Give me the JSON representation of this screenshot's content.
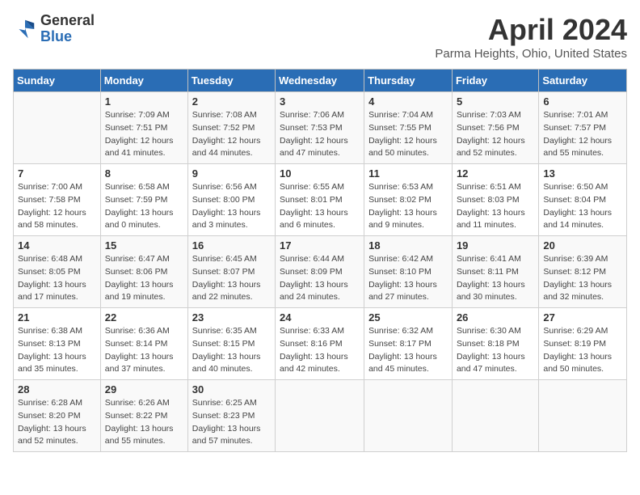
{
  "header": {
    "logo": {
      "general": "General",
      "blue": "Blue"
    },
    "title": "April 2024",
    "location": "Parma Heights, Ohio, United States"
  },
  "weekdays": [
    "Sunday",
    "Monday",
    "Tuesday",
    "Wednesday",
    "Thursday",
    "Friday",
    "Saturday"
  ],
  "weeks": [
    [
      {
        "day": "",
        "sunrise": "",
        "sunset": "",
        "daylight": ""
      },
      {
        "day": "1",
        "sunrise": "Sunrise: 7:09 AM",
        "sunset": "Sunset: 7:51 PM",
        "daylight": "Daylight: 12 hours and 41 minutes."
      },
      {
        "day": "2",
        "sunrise": "Sunrise: 7:08 AM",
        "sunset": "Sunset: 7:52 PM",
        "daylight": "Daylight: 12 hours and 44 minutes."
      },
      {
        "day": "3",
        "sunrise": "Sunrise: 7:06 AM",
        "sunset": "Sunset: 7:53 PM",
        "daylight": "Daylight: 12 hours and 47 minutes."
      },
      {
        "day": "4",
        "sunrise": "Sunrise: 7:04 AM",
        "sunset": "Sunset: 7:55 PM",
        "daylight": "Daylight: 12 hours and 50 minutes."
      },
      {
        "day": "5",
        "sunrise": "Sunrise: 7:03 AM",
        "sunset": "Sunset: 7:56 PM",
        "daylight": "Daylight: 12 hours and 52 minutes."
      },
      {
        "day": "6",
        "sunrise": "Sunrise: 7:01 AM",
        "sunset": "Sunset: 7:57 PM",
        "daylight": "Daylight: 12 hours and 55 minutes."
      }
    ],
    [
      {
        "day": "7",
        "sunrise": "Sunrise: 7:00 AM",
        "sunset": "Sunset: 7:58 PM",
        "daylight": "Daylight: 12 hours and 58 minutes."
      },
      {
        "day": "8",
        "sunrise": "Sunrise: 6:58 AM",
        "sunset": "Sunset: 7:59 PM",
        "daylight": "Daylight: 13 hours and 0 minutes."
      },
      {
        "day": "9",
        "sunrise": "Sunrise: 6:56 AM",
        "sunset": "Sunset: 8:00 PM",
        "daylight": "Daylight: 13 hours and 3 minutes."
      },
      {
        "day": "10",
        "sunrise": "Sunrise: 6:55 AM",
        "sunset": "Sunset: 8:01 PM",
        "daylight": "Daylight: 13 hours and 6 minutes."
      },
      {
        "day": "11",
        "sunrise": "Sunrise: 6:53 AM",
        "sunset": "Sunset: 8:02 PM",
        "daylight": "Daylight: 13 hours and 9 minutes."
      },
      {
        "day": "12",
        "sunrise": "Sunrise: 6:51 AM",
        "sunset": "Sunset: 8:03 PM",
        "daylight": "Daylight: 13 hours and 11 minutes."
      },
      {
        "day": "13",
        "sunrise": "Sunrise: 6:50 AM",
        "sunset": "Sunset: 8:04 PM",
        "daylight": "Daylight: 13 hours and 14 minutes."
      }
    ],
    [
      {
        "day": "14",
        "sunrise": "Sunrise: 6:48 AM",
        "sunset": "Sunset: 8:05 PM",
        "daylight": "Daylight: 13 hours and 17 minutes."
      },
      {
        "day": "15",
        "sunrise": "Sunrise: 6:47 AM",
        "sunset": "Sunset: 8:06 PM",
        "daylight": "Daylight: 13 hours and 19 minutes."
      },
      {
        "day": "16",
        "sunrise": "Sunrise: 6:45 AM",
        "sunset": "Sunset: 8:07 PM",
        "daylight": "Daylight: 13 hours and 22 minutes."
      },
      {
        "day": "17",
        "sunrise": "Sunrise: 6:44 AM",
        "sunset": "Sunset: 8:09 PM",
        "daylight": "Daylight: 13 hours and 24 minutes."
      },
      {
        "day": "18",
        "sunrise": "Sunrise: 6:42 AM",
        "sunset": "Sunset: 8:10 PM",
        "daylight": "Daylight: 13 hours and 27 minutes."
      },
      {
        "day": "19",
        "sunrise": "Sunrise: 6:41 AM",
        "sunset": "Sunset: 8:11 PM",
        "daylight": "Daylight: 13 hours and 30 minutes."
      },
      {
        "day": "20",
        "sunrise": "Sunrise: 6:39 AM",
        "sunset": "Sunset: 8:12 PM",
        "daylight": "Daylight: 13 hours and 32 minutes."
      }
    ],
    [
      {
        "day": "21",
        "sunrise": "Sunrise: 6:38 AM",
        "sunset": "Sunset: 8:13 PM",
        "daylight": "Daylight: 13 hours and 35 minutes."
      },
      {
        "day": "22",
        "sunrise": "Sunrise: 6:36 AM",
        "sunset": "Sunset: 8:14 PM",
        "daylight": "Daylight: 13 hours and 37 minutes."
      },
      {
        "day": "23",
        "sunrise": "Sunrise: 6:35 AM",
        "sunset": "Sunset: 8:15 PM",
        "daylight": "Daylight: 13 hours and 40 minutes."
      },
      {
        "day": "24",
        "sunrise": "Sunrise: 6:33 AM",
        "sunset": "Sunset: 8:16 PM",
        "daylight": "Daylight: 13 hours and 42 minutes."
      },
      {
        "day": "25",
        "sunrise": "Sunrise: 6:32 AM",
        "sunset": "Sunset: 8:17 PM",
        "daylight": "Daylight: 13 hours and 45 minutes."
      },
      {
        "day": "26",
        "sunrise": "Sunrise: 6:30 AM",
        "sunset": "Sunset: 8:18 PM",
        "daylight": "Daylight: 13 hours and 47 minutes."
      },
      {
        "day": "27",
        "sunrise": "Sunrise: 6:29 AM",
        "sunset": "Sunset: 8:19 PM",
        "daylight": "Daylight: 13 hours and 50 minutes."
      }
    ],
    [
      {
        "day": "28",
        "sunrise": "Sunrise: 6:28 AM",
        "sunset": "Sunset: 8:20 PM",
        "daylight": "Daylight: 13 hours and 52 minutes."
      },
      {
        "day": "29",
        "sunrise": "Sunrise: 6:26 AM",
        "sunset": "Sunset: 8:22 PM",
        "daylight": "Daylight: 13 hours and 55 minutes."
      },
      {
        "day": "30",
        "sunrise": "Sunrise: 6:25 AM",
        "sunset": "Sunset: 8:23 PM",
        "daylight": "Daylight: 13 hours and 57 minutes."
      },
      {
        "day": "",
        "sunrise": "",
        "sunset": "",
        "daylight": ""
      },
      {
        "day": "",
        "sunrise": "",
        "sunset": "",
        "daylight": ""
      },
      {
        "day": "",
        "sunrise": "",
        "sunset": "",
        "daylight": ""
      },
      {
        "day": "",
        "sunrise": "",
        "sunset": "",
        "daylight": ""
      }
    ]
  ]
}
